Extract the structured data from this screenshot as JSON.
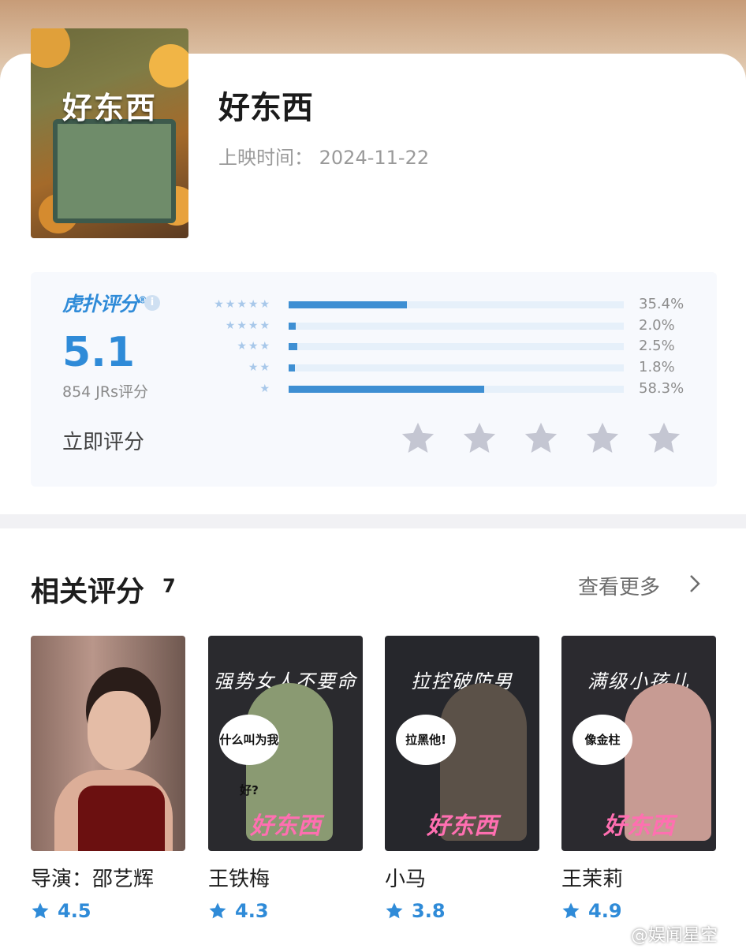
{
  "movie": {
    "title": "好东西",
    "release_label": "上映时间：",
    "release_date": "2024-11-22",
    "poster_text": "好东西"
  },
  "rating": {
    "brand": "虎扑评分",
    "brand_mark": "®",
    "info_icon": "i",
    "score": "5.1",
    "count_label": "854 JRs评分",
    "rate_now": "立即评分",
    "distribution": [
      {
        "stars": 5,
        "stars_text": "★★★★★",
        "percent": 35.4,
        "label": "35.4%"
      },
      {
        "stars": 4,
        "stars_text": "★★★★",
        "percent": 2.0,
        "label": "2.0%"
      },
      {
        "stars": 3,
        "stars_text": "★★★",
        "percent": 2.5,
        "label": "2.5%"
      },
      {
        "stars": 2,
        "stars_text": "★★",
        "percent": 1.8,
        "label": "1.8%"
      },
      {
        "stars": 1,
        "stars_text": "★",
        "percent": 58.3,
        "label": "58.3%"
      }
    ],
    "input_stars": 5
  },
  "related": {
    "title": "相关评分",
    "count": "7",
    "see_more": "查看更多",
    "items": [
      {
        "name": "导演：邵艺辉",
        "score": "4.5"
      },
      {
        "name": "王铁梅",
        "score": "4.3",
        "slogan": "强势女人不要命",
        "bubble": "什么叫为我好?",
        "poster_title": "好东西"
      },
      {
        "name": "小马",
        "score": "3.8",
        "slogan": "拉控破防男",
        "bubble": "拉黑他!",
        "poster_title": "好东西"
      },
      {
        "name": "王茉莉",
        "score": "4.9",
        "slogan": "满级小孩儿",
        "bubble": "像金柱",
        "poster_title": "好东西"
      }
    ]
  },
  "watermark": "@娱闻星空",
  "colors": {
    "accent": "#2f8bd8",
    "bar": "#3e8fd3",
    "track": "#e6f0fa",
    "input_star": "#c4c6d2"
  }
}
